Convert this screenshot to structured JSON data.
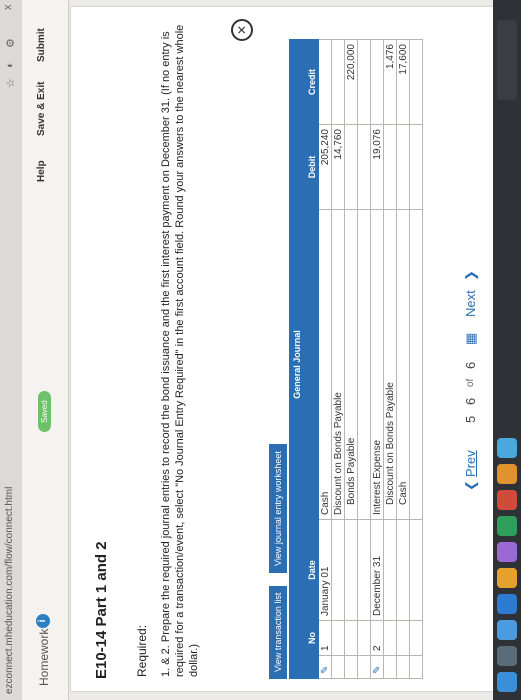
{
  "browser": {
    "url": "ezconnect.mheducation.com/flow/connect.html",
    "close_glyph": "x"
  },
  "header": {
    "homework_label": "Homework",
    "info_glyph": "i",
    "saved_label": "Saved",
    "help_label": "Help",
    "save_exit_label": "Save & Exit",
    "submit_label": "Submit"
  },
  "problem": {
    "title": "E10-14 Part 1 and 2",
    "required_label": "Required:",
    "instructions": "1. & 2. Prepare the required journal entries to record the bond issuance and the first interest payment on December 31. (If no entry is required for a transaction/event, select \"No Journal Entry Required\" in the first account field. Round your answers to the nearest whole dollar.)"
  },
  "buttons": {
    "view_transaction_list": "View transaction list",
    "view_journal_worksheet": "View journal entry worksheet"
  },
  "journal": {
    "title": "General Journal",
    "headers": {
      "no": "No",
      "date": "Date",
      "debit": "Debit",
      "credit": "Credit"
    },
    "rows": [
      {
        "no": "1",
        "date": "January 01",
        "account": "Cash",
        "debit": "205,240",
        "credit": ""
      },
      {
        "no": "",
        "date": "",
        "account": "Discount on Bonds Payable",
        "debit": "14,760",
        "credit": ""
      },
      {
        "no": "",
        "date": "",
        "account": "Bonds Payable",
        "debit": "",
        "credit": "220,000"
      },
      {
        "no": "",
        "date": "",
        "account": "",
        "debit": "",
        "credit": ""
      },
      {
        "no": "2",
        "date": "December 31",
        "account": "Interest Expense",
        "debit": "19,076",
        "credit": ""
      },
      {
        "no": "",
        "date": "",
        "account": "Discount on Bonds Payable",
        "debit": "",
        "credit": "1,476"
      },
      {
        "no": "",
        "date": "",
        "account": "Cash",
        "debit": "",
        "credit": "17,600"
      },
      {
        "no": "",
        "date": "",
        "account": "",
        "debit": "",
        "credit": ""
      }
    ]
  },
  "pagination": {
    "prev_label": "Prev",
    "current": "5",
    "pages_a": "6",
    "of_label": "of",
    "pages_b": "6",
    "next_label": "Next"
  },
  "colors": {
    "accent": "#2a6eb3",
    "saved": "#6fc06a",
    "taskbar": "#2e3136"
  }
}
